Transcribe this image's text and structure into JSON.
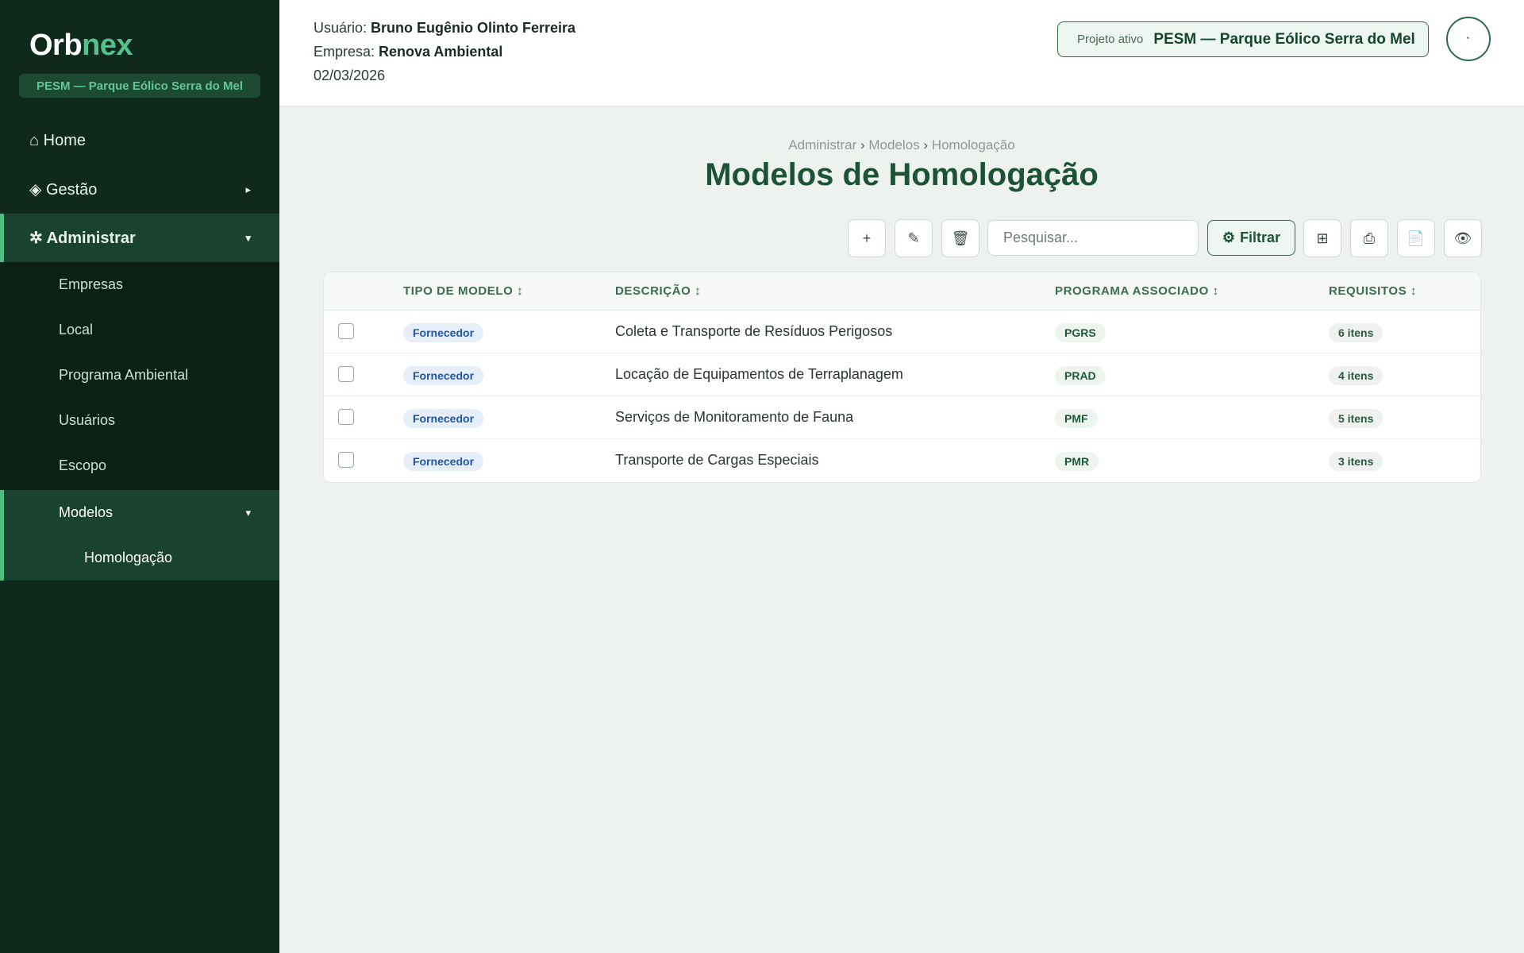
{
  "brand": {
    "logo_part1": "Orb",
    "logo_part2": "nex",
    "project_pill": "PESM — Parque Eólico Serra do Mel"
  },
  "sidebar": {
    "items": [
      {
        "icon": "home-icon",
        "label": "⌂ Home"
      },
      {
        "icon": "diamond-icon",
        "label": "◈ Gestão",
        "caret": "▸"
      },
      {
        "icon": "asterisk-icon",
        "label": "✲ Administrar",
        "caret": "▾"
      }
    ],
    "admin_sub": [
      {
        "label": "Empresas"
      },
      {
        "label": "Local"
      },
      {
        "label": "Programa Ambiental"
      },
      {
        "label": "Usuários"
      },
      {
        "label": "Escopo"
      },
      {
        "label": "Modelos",
        "caret": "▾"
      }
    ],
    "modelos_sub": [
      {
        "label": "Homologação"
      }
    ]
  },
  "header": {
    "user_label": "Usuário:",
    "user_name": "Bruno Eugênio Olinto Ferreira",
    "company_label": "Empresa:",
    "company_name": "Renova Ambiental",
    "date": "02/03/2026",
    "active_project_label": "Projeto ativo",
    "active_project_value": "PESM — Parque Eólico Serra do Mel"
  },
  "breadcrumb": {
    "items": [
      "Administrar",
      "Modelos",
      "Homologação"
    ],
    "separator": "›"
  },
  "page_title": "Modelos de Homologação",
  "toolbar": {
    "add_icon": "+",
    "edit_icon": "✎",
    "delete_icon": "🗑",
    "search_placeholder": "Pesquisar...",
    "filter_icon": "⚙",
    "filter_label": "Filtrar",
    "grid_icon": "⊞",
    "export_icon": "⎙",
    "document_icon": "📄",
    "view_icon": "👁"
  },
  "table": {
    "columns": [
      {
        "label": "TIPO DE MODELO ↕"
      },
      {
        "label": "DESCRIÇÃO ↕"
      },
      {
        "label": "PROGRAMA ASSOCIADO ↕"
      },
      {
        "label": "REQUISITOS ↕"
      }
    ],
    "rows": [
      {
        "tipo": "Fornecedor",
        "descricao": "Coleta e Transporte de Resíduos Perigosos",
        "programa": "PGRS",
        "requisitos": "6 itens"
      },
      {
        "tipo": "Fornecedor",
        "descricao": "Locação de Equipamentos de Terraplanagem",
        "programa": "PRAD",
        "requisitos": "4 itens"
      },
      {
        "tipo": "Fornecedor",
        "descricao": "Serviços de Monitoramento de Fauna",
        "programa": "PMF",
        "requisitos": "5 itens"
      },
      {
        "tipo": "Fornecedor",
        "descricao": "Transporte de Cargas Especiais",
        "programa": "PMR",
        "requisitos": "3 itens"
      }
    ]
  },
  "colors": {
    "sidebar_bg": "#0f2a1d",
    "accent": "#4fbf84",
    "title": "#1c5235",
    "tag_blue": "#1d57a8"
  }
}
